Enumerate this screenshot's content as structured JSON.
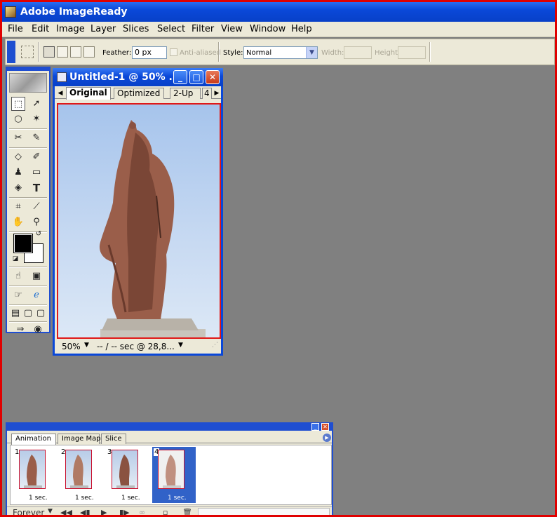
{
  "window": {
    "title": "Adobe ImageReady"
  },
  "menu": [
    "File",
    "Edit",
    "Image",
    "Layer",
    "Slices",
    "Select",
    "Filter",
    "View",
    "Window",
    "Help"
  ],
  "options": {
    "feather_label": "Feather:",
    "feather_value": "0 px",
    "anti_aliased_label": "Anti-aliased",
    "style_label": "Style:",
    "style_value": "Normal",
    "width_label": "Width:",
    "height_label": "Height:"
  },
  "document": {
    "title": "Untitled-1 @ 50% ...",
    "tabs": [
      "Original",
      "Optimized",
      "2-Up",
      "4"
    ],
    "zoom": "50%",
    "status": "-- / -- sec @ 28,8..."
  },
  "animation_palette": {
    "tabs": [
      "Animation",
      "Image Map",
      "Slice"
    ],
    "frames": [
      {
        "num": "1",
        "delay": "1 sec."
      },
      {
        "num": "2",
        "delay": "1 sec."
      },
      {
        "num": "3",
        "delay": "1 sec."
      },
      {
        "num": "4",
        "delay": "1 sec."
      }
    ],
    "loop": "Forever"
  },
  "colors": {
    "titlebar": "#0a48d8",
    "chrome": "#ece9d8",
    "workspace": "#808080",
    "border": "#e00000"
  }
}
